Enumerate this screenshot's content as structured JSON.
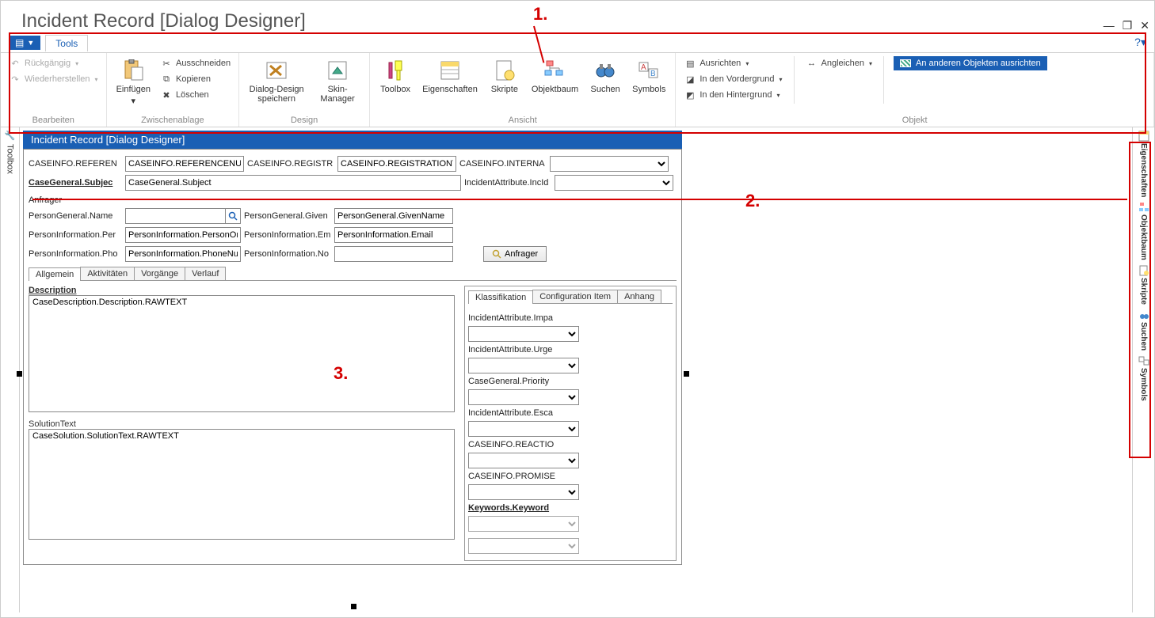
{
  "title": "Incident Record [Dialog Designer]",
  "ribbon_tab": "Tools",
  "ribbon": {
    "bearbeiten": {
      "undo": "Rückgängig",
      "redo": "Wiederherstellen",
      "label": "Bearbeiten"
    },
    "clipboard": {
      "paste": "Einfügen",
      "cut": "Ausschneiden",
      "copy": "Kopieren",
      "delete": "Löschen",
      "label": "Zwischenablage"
    },
    "design": {
      "save": "Dialog-Design speichern",
      "skin": "Skin-Manager",
      "label": "Design"
    },
    "ansicht": {
      "toolbox": "Toolbox",
      "props": "Eigenschaften",
      "scripts": "Skripte",
      "tree": "Objektbaum",
      "search": "Suchen",
      "symbols": "Symbols",
      "label": "Ansicht"
    },
    "objekt": {
      "align": "Ausrichten",
      "tofront": "In den Vordergrund",
      "toback": "In den Hintergrund",
      "angleichen": "Angleichen",
      "alignothers": "An anderen Objekten ausrichten",
      "label": "Objekt"
    }
  },
  "left_rail": {
    "toolbox": "Toolbox"
  },
  "right_rail": {
    "props": "Eigenschaften",
    "tree": "Objektbaum",
    "scripts": "Skripte",
    "search": "Suchen",
    "symbols": "Symbols"
  },
  "designer_title": "Incident Record [Dialog Designer]",
  "fields": {
    "caseinfo_ref_label": "CASEINFO.REFEREN",
    "caseinfo_ref_value": "CASEINFO.REFERENCENUM",
    "caseinfo_reg_label": "CASEINFO.REGISTR",
    "caseinfo_reg_value": "CASEINFO.REGISTRATIONT",
    "caseinfo_int_label": "CASEINFO.INTERNA",
    "subject_label": "CaseGeneral.Subjec",
    "subject_value": "CaseGeneral.Subject",
    "incattr_label": "IncidentAttribute.IncId",
    "anfrager_section": "Anfrager",
    "pg_name_label": "PersonGeneral.Name",
    "pg_given_label": "PersonGeneral.Given",
    "pg_given_value": "PersonGeneral.GivenName",
    "pi_per_label": "PersonInformation.Per",
    "pi_per_value": "PersonInformation.PersonOrga",
    "pi_em_label": "PersonInformation.Em",
    "pi_em_value": "PersonInformation.Email",
    "pi_ph_label": "PersonInformation.Pho",
    "pi_ph_value": "PersonInformation.PhoneNumb",
    "pi_no_label": "PersonInformation.No",
    "anfrager_btn": "Anfrager"
  },
  "tabs_main": [
    "Allgemein",
    "Aktivitäten",
    "Vorgänge",
    "Verlauf"
  ],
  "description": {
    "label": "Description",
    "value": "CaseDescription.Description.RAWTEXT"
  },
  "solution": {
    "label": "SolutionText",
    "value": "CaseSolution.SolutionText.RAWTEXT"
  },
  "tabs_right": [
    "Klassifikation",
    "Configuration Item",
    "Anhang"
  ],
  "klass": {
    "impact": "IncidentAttribute.Impa",
    "urgency": "IncidentAttribute.Urge",
    "priority": "CaseGeneral.Priority",
    "esca": "IncidentAttribute.Esca",
    "reactio": "CASEINFO.REACTIO",
    "promise": "CASEINFO.PROMISE",
    "keywords": "Keywords.Keyword"
  },
  "annotations": {
    "one": "1.",
    "two": "2.",
    "three": "3."
  }
}
